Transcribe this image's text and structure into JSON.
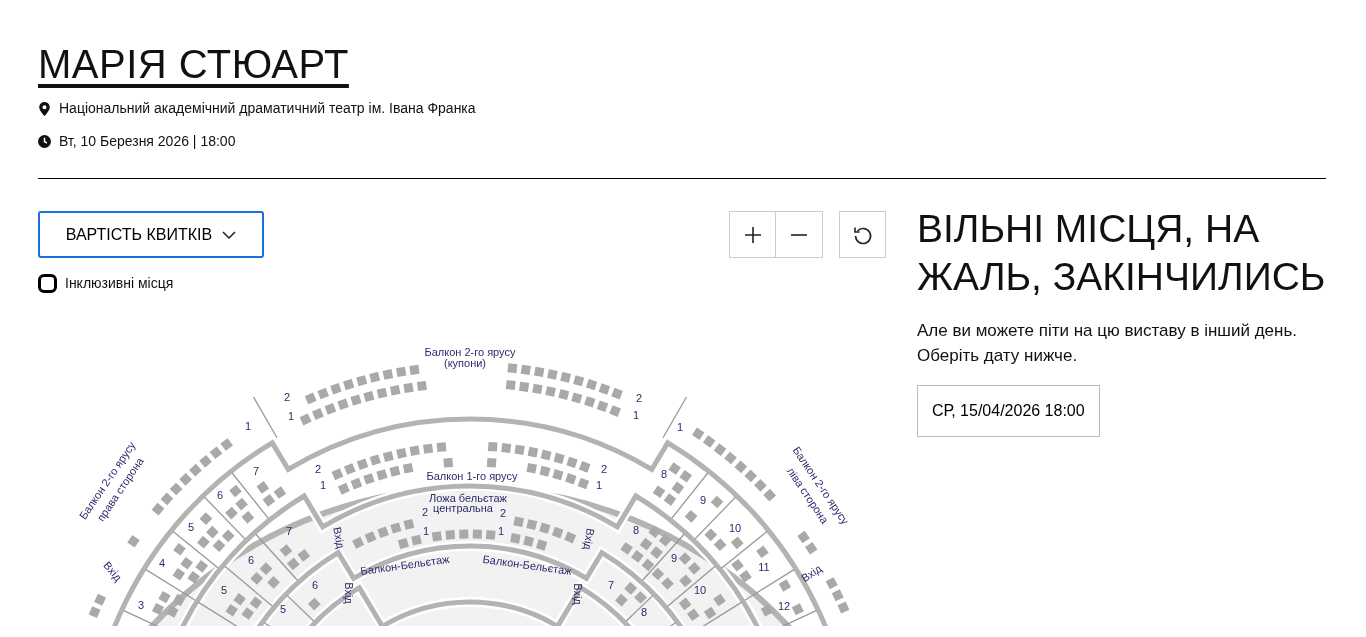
{
  "title": "МАРІЯ СТЮАРТ",
  "venue": "Національний академічний драматичний театр ім. Івана Франка",
  "datetime": "Вт, 10 Березня 2026 | 18:00",
  "price_dropdown": {
    "label": "ВАРТІСТЬ КВИТКІВ",
    "expanded": false
  },
  "inclusive_checkbox": {
    "label": "Інклюзивні місця",
    "checked": false
  },
  "seat_map": {
    "section_labels": [
      {
        "lines": [
          "Балкон 2-го ярусу",
          "(купони)"
        ]
      },
      {
        "lines": [
          "Балкон 2-го ярусу",
          "права сторона"
        ]
      },
      {
        "lines": [
          "Балкон 2-го ярусу",
          "ліва сторона"
        ]
      },
      {
        "lines": [
          "Балкон 1-го ярусу"
        ]
      },
      {
        "lines": [
          "Ложа бельєтаж",
          "центральна"
        ]
      },
      {
        "lines": [
          "Балкон-Бельєтаж"
        ]
      },
      {
        "lines": [
          "Балкон-Бельєтаж"
        ]
      }
    ],
    "entrance_labels": [
      "Вхід",
      "Вхід",
      "Вхід",
      "Вхід",
      "Вхід",
      "Вхід"
    ],
    "row_numbers": [
      "2",
      "1",
      "1",
      "7",
      "6",
      "5",
      "4",
      "3",
      "2",
      "1",
      "7",
      "6",
      "5",
      "6",
      "5",
      "2",
      "1",
      "2",
      "1",
      "1",
      "2",
      "1",
      "2",
      "1",
      "8",
      "9",
      "10",
      "11",
      "12",
      "8",
      "9",
      "10",
      "7",
      "8"
    ]
  },
  "notice": {
    "heading": "ВІЛЬНІ МІСЦЯ, НА ЖАЛЬ, ЗАКІНЧИЛИСЬ",
    "text": "Але ви можете піти на цю виставу в інший день. Оберіть дату нижче.",
    "dates": [
      {
        "label": "СР, 15/04/2026 18:00",
        "selected": false
      }
    ]
  }
}
